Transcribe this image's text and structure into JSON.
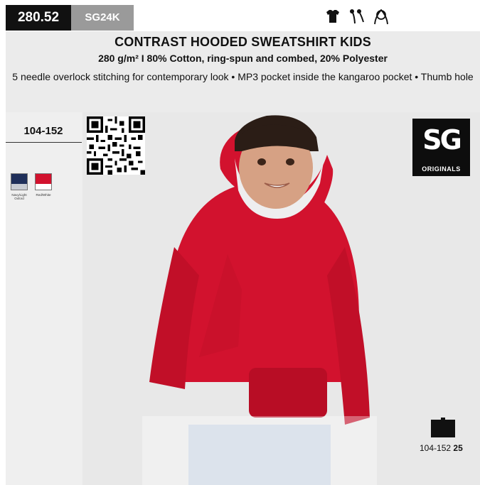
{
  "header": {
    "code": "280.52",
    "sku": "SG24K",
    "icons": [
      "tshirt-icon",
      "drawstring-icon",
      "hood-icon"
    ]
  },
  "product": {
    "title": "CONTRAST HOODED SWEATSHIRT KIDS",
    "subtitle": "280 g/m² I 80% Cotton, ring-spun and combed, 20% Polyester",
    "features": "5 needle overlock stitching for contemporary look • MP3 pocket inside the kangaroo pocket • Thumb hole"
  },
  "sizes": {
    "range": "104-152"
  },
  "colors": [
    {
      "label": "Navy/Light Oxford",
      "main": "#1f2f5a",
      "contrast": "#c9ccd3"
    },
    {
      "label": "Red/White",
      "main": "#d2122e",
      "contrast": "#ffffff"
    }
  ],
  "brand": {
    "mark": "SG",
    "sub": "ORIGINALS"
  },
  "packing": {
    "sizes": "104-152",
    "count": "25"
  },
  "theme": {
    "dark": "#111111",
    "grey_badge": "#9a9a9a",
    "band": "#ebebeb",
    "hoodie_red": "#d2122e"
  }
}
